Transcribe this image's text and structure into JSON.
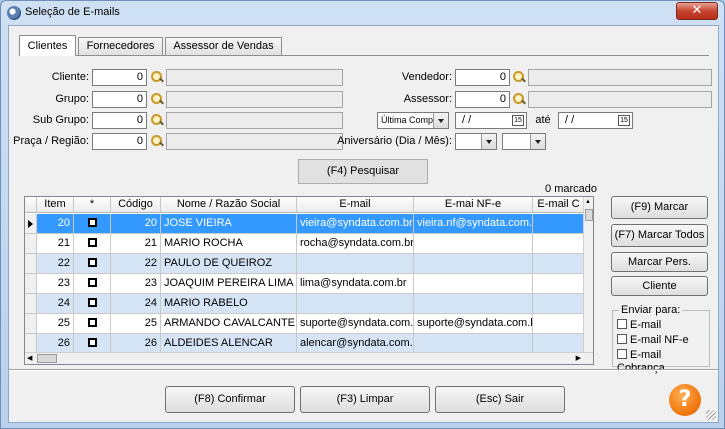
{
  "window": {
    "title": "Seleção de E-mails",
    "close_glyph": "✕"
  },
  "tabs": [
    {
      "label": "Clientes",
      "active": true
    },
    {
      "label": "Fornecedores",
      "active": false
    },
    {
      "label": "Assessor de Vendas",
      "active": false
    }
  ],
  "filters": {
    "cliente": {
      "label": "Cliente:",
      "value": "0"
    },
    "grupo": {
      "label": "Grupo:",
      "value": "0"
    },
    "subgrupo": {
      "label": "Sub Grupo:",
      "value": "0"
    },
    "praca": {
      "label": "Praça / Região:",
      "value": "0"
    },
    "vendedor": {
      "label": "Vendedor:",
      "value": "0"
    },
    "assessor": {
      "label": "Assessor:",
      "value": "0"
    },
    "periodo": {
      "option": "Última Compra",
      "date_from": "/  /",
      "ate_label": "até",
      "date_to": "/  /",
      "calendar_glyph": "15"
    },
    "aniversario": {
      "label": "Aniversário (Dia / Mês):"
    }
  },
  "buttons": {
    "pesquisar": "(F4) Pesquisar",
    "marcar": "(F9) Marcar",
    "marcar_todos": "(F7) Marcar Todos",
    "marcar_pers": "Marcar Pers.",
    "cliente": "Cliente",
    "confirmar": "(F8) Confirmar",
    "limpar": "(F3) Limpar",
    "sair": "(Esc) Sair"
  },
  "grid": {
    "marked_count": "0 marcado",
    "columns": [
      "Item",
      "*",
      "Código",
      "Nome / Razão Social",
      "E-mail",
      "E-mai NF-e",
      "E-mail C"
    ],
    "rows": [
      {
        "item": "20",
        "code": "20",
        "name": "JOSE VIEIRA",
        "email": "vieira@syndata.com.br",
        "email_nfe": "vieira.nf@syndata.com.br",
        "selected": true
      },
      {
        "item": "21",
        "code": "21",
        "name": "MARIO ROCHA",
        "email": "rocha@syndata.com.br",
        "email_nfe": "",
        "selected": false
      },
      {
        "item": "22",
        "code": "22",
        "name": "PAULO DE QUEIROZ",
        "email": "",
        "email_nfe": "",
        "selected": false
      },
      {
        "item": "23",
        "code": "23",
        "name": "JOAQUIM PEREIRA LIMA",
        "email": "lima@syndata.com.br",
        "email_nfe": "",
        "selected": false
      },
      {
        "item": "24",
        "code": "24",
        "name": "MARIO RABELO",
        "email": "",
        "email_nfe": "",
        "selected": false
      },
      {
        "item": "25",
        "code": "25",
        "name": "ARMANDO CAVALCANTE",
        "email": "suporte@syndata.com.br",
        "email_nfe": "suporte@syndata.com.br",
        "selected": false
      },
      {
        "item": "26",
        "code": "26",
        "name": "ALDEIDES ALENCAR",
        "email": "alencar@syndata.com.br",
        "email_nfe": "",
        "selected": false
      }
    ]
  },
  "enviar": {
    "title": "Enviar para:",
    "options": [
      "E-mail",
      "E-mail NF-e",
      "E-mail Cobrança"
    ]
  },
  "help_glyph": "?",
  "colors": {
    "selected_row": "#3399ff",
    "alt_row": "#d6e5f5"
  }
}
